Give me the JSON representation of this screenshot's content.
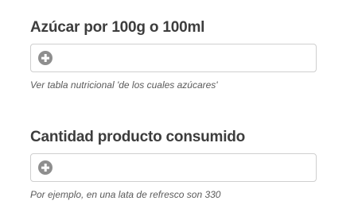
{
  "fields": [
    {
      "label": "Azúcar por 100g o 100ml",
      "value": "",
      "hint": "Ver tabla nutricional 'de los cuales azúcares'"
    },
    {
      "label": "Cantidad producto consumido",
      "value": "",
      "hint": "Por ejemplo, en una lata de refresco son 330"
    }
  ],
  "icons": {
    "input_prefix": "plus-circle-icon"
  },
  "colors": {
    "label": "#3d3d3d",
    "hint": "#5a5a5a",
    "icon": "#8e8e8e",
    "border": "#cfcfcf"
  }
}
